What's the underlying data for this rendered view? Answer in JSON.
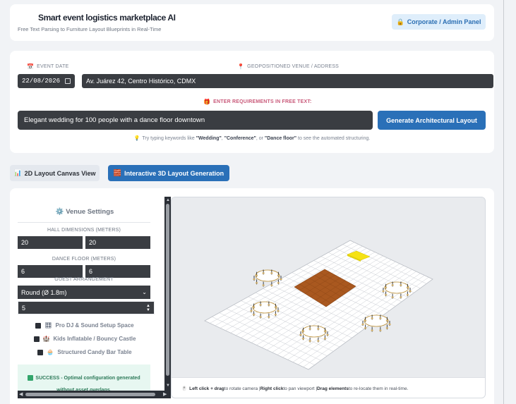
{
  "header": {
    "title": "Smart event logistics marketplace AI",
    "subtitle": "Free Text Parsing to Furniture Layout Blueprints in Real-Time",
    "admin_button": "Corporate / Admin Panel"
  },
  "form": {
    "event_date_label": "EVENT DATE",
    "event_date_value": "22/08/2026",
    "venue_label": "GEOPOSITIONED VENUE / ADDRESS",
    "venue_value": "Av. Juárez 42, Centro Histórico, CDMX",
    "requirements_label": "ENTER REQUIREMENTS IN FREE TEXT:",
    "requirements_value": "Elegant wedding for 100 people with a dance floor downtown",
    "generate_button": "Generate Architectural Layout",
    "hint": {
      "prefix": "Try typing keywords like ",
      "kw1": "\"Wedding\"",
      "sep1": ", ",
      "kw2": "\"Conference\"",
      "sep2": ", or ",
      "kw3": "\"Dance floor\"",
      "suffix": " to see the automated structuring."
    }
  },
  "tabs": {
    "tab_2d": "2D Layout Canvas View",
    "tab_3d": "Interactive 3D Layout Generation"
  },
  "settings": {
    "title": "Venue Settings",
    "hall_label": "HALL DIMENSIONS (METERS)",
    "hall_width": "20",
    "hall_length": "20",
    "dance_label": "DANCE FLOOR (METERS)",
    "dance_width": "6",
    "dance_length": "6",
    "guest_label": "GUEST ARRANGEMENT",
    "arrangement": "Round (Ø 1.8m)",
    "count": "5",
    "options": [
      {
        "label": "Pro DJ & Sound Setup Space",
        "icon": "🎛"
      },
      {
        "label": "Kids Inflatable / Bouncy Castle",
        "icon": "🏰"
      },
      {
        "label": "Structured Candy Bar Table",
        "icon": "🧁"
      }
    ],
    "success_line1": "SUCCESS - Optimal configuration generated",
    "success_line2": "without asset overlaps."
  },
  "viewport": {
    "footer": {
      "b1": "Left click + drag",
      "t1": " to rotate camera | ",
      "b2": "Right click",
      "t2": " to pan viewport | ",
      "b3": "Drag elements",
      "t3": " to re-locate them in real-time."
    },
    "colors": {
      "floor": "#ffffff",
      "grid": "#c9ccd2",
      "dance_floor": "#a9581f",
      "table_stroke": "#b8892a",
      "stage": "#f5e214"
    }
  }
}
